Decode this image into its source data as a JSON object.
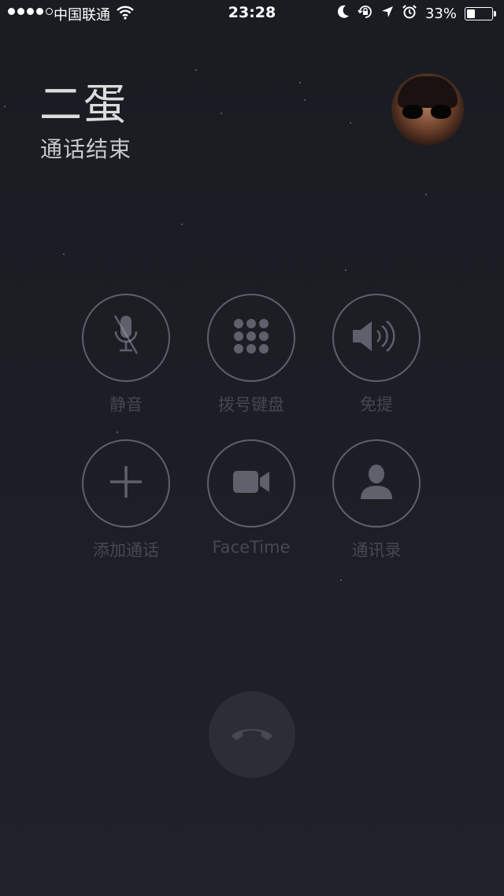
{
  "status_bar": {
    "signal_icon": "signal-dots-icon",
    "carrier": "中国联通",
    "wifi_icon": "wifi-icon",
    "time": "23:28",
    "icons": [
      "moon-icon",
      "orientation-lock-icon",
      "location-arrow-icon",
      "alarm-icon"
    ],
    "battery_percent": "33%",
    "battery_level": 0.33
  },
  "caller": {
    "name": "二蛋",
    "status": "通话结束",
    "avatar": "contact-photo"
  },
  "controls": [
    {
      "label": "静音",
      "icon": "mute-microphone-icon"
    },
    {
      "label": "拨号键盘",
      "icon": "keypad-icon"
    },
    {
      "label": "免提",
      "icon": "speaker-icon"
    },
    {
      "label": "添加通话",
      "icon": "plus-icon"
    },
    {
      "label": "FaceTime",
      "icon": "video-camera-icon"
    },
    {
      "label": "通讯录",
      "icon": "contact-person-icon"
    }
  ],
  "end_call": {
    "icon": "phone-hangup-icon"
  },
  "colors": {
    "background": "#1c1e25",
    "text": "#dcdcdc",
    "button_border": "#96a0a5"
  }
}
